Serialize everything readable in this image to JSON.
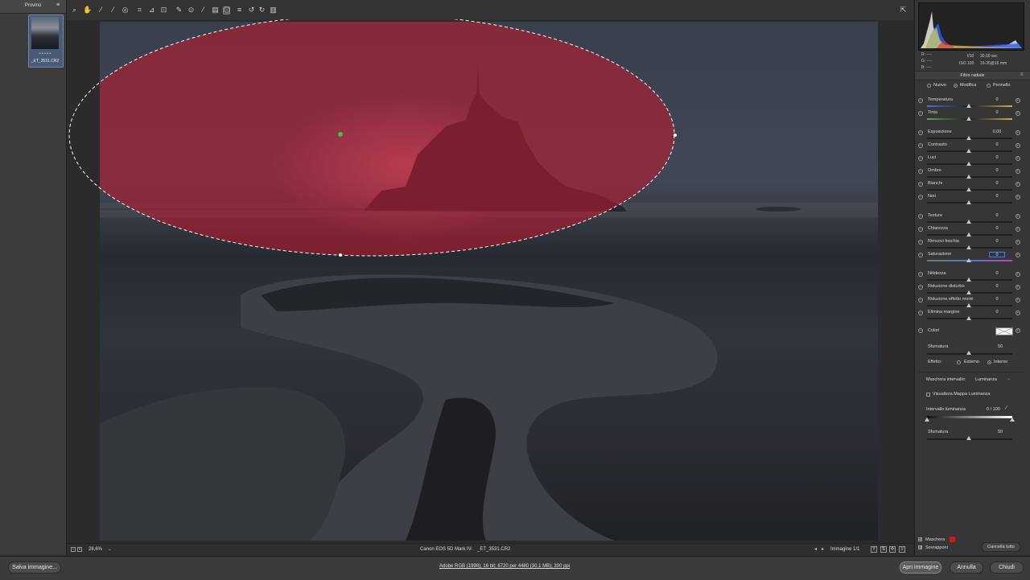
{
  "filmstrip": {
    "title": "Provino",
    "rating_dots": "• • • • •",
    "file_name": "_ET_3531.CR2"
  },
  "toolbar": {
    "icons": [
      "zoom-icon",
      "hand-icon",
      "white-balance-icon",
      "color-sampler-icon",
      "target-adjust-icon",
      "crop-icon",
      "straighten-icon",
      "transform-icon",
      "spot-removal-icon",
      "red-eye-icon",
      "brush-icon",
      "graduated-filter-icon",
      "radial-filter-icon",
      "presets-icon",
      "rotate-left-icon",
      "rotate-right-icon",
      "trash-icon"
    ]
  },
  "preview": {
    "zoom": "28,6%",
    "camera": "Canon EOS 5D Mark IV",
    "separator": "-",
    "file": "_ET_3531.CR2",
    "image_counter": "Immagine 1/1"
  },
  "histogram": {
    "r_label": "R:",
    "r_value": "----",
    "g_label": "G:",
    "g_value": "----",
    "b_label": "B:",
    "b_value": "----",
    "aperture": "f/10",
    "shutter": "30,00 sec",
    "iso": "ISO 100",
    "lens": "16-35@16 mm"
  },
  "panel": {
    "title": "Filtro radiale",
    "mode_new": "Nuovo",
    "mode_edit": "Modifica",
    "mode_brush": "Pennello",
    "group1": [
      {
        "label": "Temperatura",
        "value": "0",
        "accent": "#4a6fd0"
      },
      {
        "label": "Tinta",
        "value": "0",
        "accent": "#5aaa4a"
      }
    ],
    "group2": [
      {
        "label": "Esposizione",
        "value": "0,00"
      },
      {
        "label": "Contrasto",
        "value": "0"
      },
      {
        "label": "Luci",
        "value": "0"
      },
      {
        "label": "Ombre",
        "value": "0"
      },
      {
        "label": "Bianchi",
        "value": "0"
      },
      {
        "label": "Neri",
        "value": "0"
      }
    ],
    "group3": [
      {
        "label": "Texture",
        "value": "0"
      },
      {
        "label": "Chiarezza",
        "value": "0"
      },
      {
        "label": "Rimuovi foschia",
        "value": "0"
      },
      {
        "label": "Saturazione",
        "value": "0"
      }
    ],
    "group4": [
      {
        "label": "Nitidezza",
        "value": "0"
      },
      {
        "label": "Riduzione disturbo",
        "value": "0"
      },
      {
        "label": "Riduzione effetto moiré",
        "value": "0"
      },
      {
        "label": "Elimina margine",
        "value": "0"
      }
    ],
    "colors_label": "Colori",
    "feather_label": "Sfumatura",
    "feather_value": "50",
    "effect_label": "Effetto:",
    "effect_outside": "Esterno",
    "effect_inside": "Interno",
    "range_mask_label": "Maschera intervallo:",
    "range_mask_value": "Luminanza",
    "show_lum_map": "Visualizza Mappa Luminanza",
    "lum_range_label": "Intervallo luminanza",
    "lum_range_value": "0 / 100",
    "smooth_label": "Sfumatura",
    "smooth_value": "50",
    "mask_label": "Maschera",
    "overlay_label": "Sovrapponi",
    "clear_all": "Cancella tutto",
    "mask_color": "#d01818"
  },
  "status": {
    "save_button": "Salva immagine...",
    "workflow_link": "Adobe RGB (1998); 16 bit; 6720 per 4480 (30,1 MB); 300 ppi",
    "open_button": "Apri immagine",
    "cancel_button": "Annulla",
    "close_button": "Chiudi"
  }
}
